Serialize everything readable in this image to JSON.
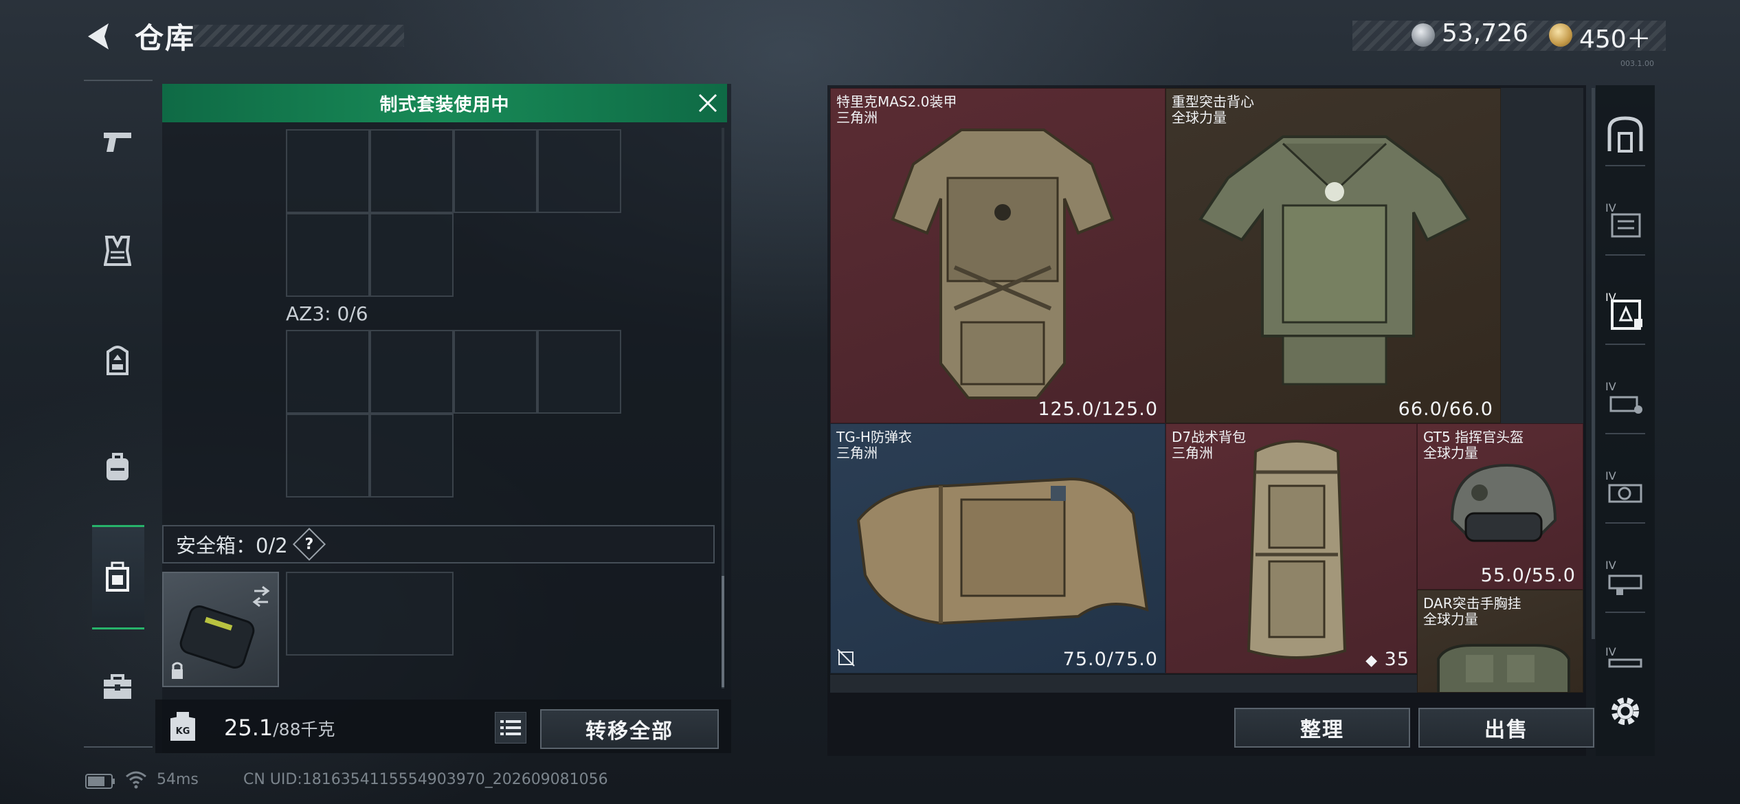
{
  "header": {
    "title": "仓库"
  },
  "currency": {
    "silver": "53,726",
    "gold": "450＋",
    "version_tag": "003.1.00"
  },
  "left_rail": {
    "items": [
      {
        "name": "weapons-pistol-icon"
      },
      {
        "name": "chest-rig-icon"
      },
      {
        "name": "backpack-icon"
      },
      {
        "name": "bag-icon"
      },
      {
        "name": "safe-case-icon"
      },
      {
        "name": "toolbox-icon"
      }
    ]
  },
  "loadout": {
    "banner": "制式套装使用中",
    "az3_label": "AZ3: 0/6",
    "safebox_label": "安全箱：0/2",
    "help": "?",
    "weight_value": "25.1",
    "weight_max": "/88千克",
    "transfer_all": "转移全部",
    "kg": "KG"
  },
  "inventory": {
    "items": [
      {
        "name": "特里克MAS2.0装甲",
        "source": "三角洲",
        "durability": "125.0/125.0",
        "rarity": "red"
      },
      {
        "name": "重型突击背心",
        "source": "全球力量",
        "durability": "66.0/66.0",
        "rarity": "brown"
      },
      {
        "name": "TG-H防弹衣",
        "source": "三角洲",
        "durability": "75.0/75.0",
        "rarity": "blue"
      },
      {
        "name": "D7战术背包",
        "source": "三角洲",
        "count": "35",
        "rarity": "red"
      },
      {
        "name": "GT5 指挥官头盔",
        "source": "全球力量",
        "durability": "55.0/55.0",
        "rarity": "red"
      },
      {
        "name": "DAR突击手胸挂",
        "source": "全球力量",
        "rarity": "brown"
      }
    ],
    "sort_label": "整理",
    "sell_label": "出售"
  },
  "status_bar": {
    "ping": "54ms",
    "uid": "CN UID:1816354115554903970_202609081056"
  },
  "colors": {
    "accent_green": "#188a57",
    "rarity_red": "#5a2c33",
    "rarity_brown": "#3d342a",
    "rarity_blue": "#2b3e54"
  }
}
